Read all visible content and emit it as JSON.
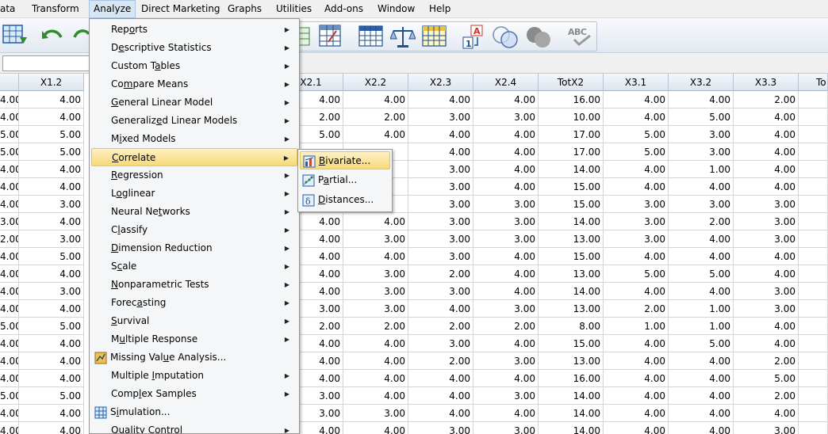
{
  "menubar": {
    "items": [
      "ata",
      "Transform",
      "Analyze",
      "Direct Marketing",
      "Graphs",
      "Utilities",
      "Add-ons",
      "Window",
      "Help"
    ]
  },
  "analyze_menu": {
    "items": [
      {
        "label": "Reports",
        "submenu": true
      },
      {
        "label": "Descriptive Statistics",
        "submenu": true
      },
      {
        "label": "Custom Tables",
        "submenu": true
      },
      {
        "label": "Compare Means",
        "submenu": true
      },
      {
        "label": "General Linear Model",
        "submenu": true
      },
      {
        "label": "Generalized Linear Models",
        "submenu": true
      },
      {
        "label": "Mixed Models",
        "submenu": true
      },
      {
        "label": "Correlate",
        "submenu": true
      },
      {
        "label": "Regression",
        "submenu": true
      },
      {
        "label": "Loglinear",
        "submenu": true
      },
      {
        "label": "Neural Networks",
        "submenu": true
      },
      {
        "label": "Classify",
        "submenu": true
      },
      {
        "label": "Dimension Reduction",
        "submenu": true
      },
      {
        "label": "Scale",
        "submenu": true
      },
      {
        "label": "Nonparametric Tests",
        "submenu": true
      },
      {
        "label": "Forecasting",
        "submenu": true
      },
      {
        "label": "Survival",
        "submenu": true
      },
      {
        "label": "Multiple Response",
        "submenu": true
      },
      {
        "label": "Missing Value Analysis...",
        "submenu": false,
        "icon": "missing-value-icon"
      },
      {
        "label": "Multiple Imputation",
        "submenu": true
      },
      {
        "label": "Complex Samples",
        "submenu": true
      },
      {
        "label": "Simulation...",
        "submenu": false,
        "icon": "simulation-icon"
      },
      {
        "label": "Quality Control",
        "submenu": true
      }
    ],
    "highlighted": "Correlate"
  },
  "correlate_menu": {
    "items": [
      {
        "label": "Bivariate...",
        "icon": "bivariate-icon"
      },
      {
        "label": "Partial...",
        "icon": "partial-icon"
      },
      {
        "label": "Distances...",
        "icon": "distances-icon"
      }
    ],
    "highlighted": "Bivariate..."
  },
  "toolbar": {
    "icons": [
      "dataset-icon",
      "undo-icon",
      "redo-icon",
      "goto-icon",
      "variables-icon",
      "run-descriptives-icon",
      "split-file-icon",
      "weight-cases-icon",
      "select-cases-icon",
      "value-labels-icon",
      "use-sets-icon",
      "show-all-variables-icon",
      "spell-check-icon"
    ],
    "spell_text": "ABC"
  },
  "grid": {
    "left_headers": [
      "",
      "X1.2"
    ],
    "right_headers": [
      "X2.1",
      "X2.2",
      "X2.3",
      "X2.4",
      "TotX2",
      "X3.1",
      "X3.2",
      "X3.3",
      "To"
    ],
    "rows": [
      [
        "4.00",
        "4.00",
        "4.00",
        "4.00",
        "4.00",
        "4.00",
        "16.00",
        "4.00",
        "4.00",
        "2.00"
      ],
      [
        "4.00",
        "4.00",
        "2.00",
        "2.00",
        "3.00",
        "3.00",
        "10.00",
        "4.00",
        "5.00",
        "4.00"
      ],
      [
        "5.00",
        "5.00",
        "5.00",
        "4.00",
        "4.00",
        "4.00",
        "17.00",
        "5.00",
        "3.00",
        "4.00"
      ],
      [
        "5.00",
        "5.00",
        "",
        "",
        "4.00",
        "4.00",
        "17.00",
        "5.00",
        "3.00",
        "4.00"
      ],
      [
        "4.00",
        "4.00",
        "",
        "",
        "3.00",
        "4.00",
        "14.00",
        "4.00",
        "1.00",
        "4.00"
      ],
      [
        "4.00",
        "4.00",
        "",
        "",
        "3.00",
        "4.00",
        "15.00",
        "4.00",
        "4.00",
        "4.00"
      ],
      [
        "4.00",
        "3.00",
        "",
        "",
        "3.00",
        "3.00",
        "15.00",
        "3.00",
        "3.00",
        "3.00"
      ],
      [
        "3.00",
        "4.00",
        "4.00",
        "4.00",
        "3.00",
        "3.00",
        "14.00",
        "3.00",
        "2.00",
        "3.00"
      ],
      [
        "2.00",
        "3.00",
        "4.00",
        "3.00",
        "3.00",
        "3.00",
        "13.00",
        "3.00",
        "4.00",
        "3.00"
      ],
      [
        "4.00",
        "5.00",
        "4.00",
        "4.00",
        "3.00",
        "4.00",
        "15.00",
        "4.00",
        "4.00",
        "4.00"
      ],
      [
        "4.00",
        "4.00",
        "4.00",
        "3.00",
        "2.00",
        "4.00",
        "13.00",
        "5.00",
        "5.00",
        "4.00"
      ],
      [
        "4.00",
        "3.00",
        "4.00",
        "3.00",
        "3.00",
        "4.00",
        "14.00",
        "4.00",
        "4.00",
        "3.00"
      ],
      [
        "4.00",
        "4.00",
        "3.00",
        "3.00",
        "4.00",
        "3.00",
        "13.00",
        "2.00",
        "1.00",
        "3.00"
      ],
      [
        "5.00",
        "5.00",
        "2.00",
        "2.00",
        "2.00",
        "2.00",
        "8.00",
        "1.00",
        "1.00",
        "4.00"
      ],
      [
        "4.00",
        "4.00",
        "4.00",
        "4.00",
        "3.00",
        "4.00",
        "15.00",
        "4.00",
        "5.00",
        "4.00"
      ],
      [
        "4.00",
        "4.00",
        "4.00",
        "4.00",
        "2.00",
        "3.00",
        "13.00",
        "4.00",
        "4.00",
        "2.00"
      ],
      [
        "4.00",
        "4.00",
        "4.00",
        "4.00",
        "4.00",
        "4.00",
        "16.00",
        "4.00",
        "4.00",
        "5.00"
      ],
      [
        "5.00",
        "5.00",
        "3.00",
        "4.00",
        "4.00",
        "3.00",
        "14.00",
        "4.00",
        "4.00",
        "2.00"
      ],
      [
        "4.00",
        "4.00",
        "3.00",
        "3.00",
        "4.00",
        "4.00",
        "14.00",
        "4.00",
        "4.00",
        "4.00"
      ],
      [
        "4.00",
        "4.00",
        "4.00",
        "4.00",
        "3.00",
        "3.00",
        "14.00",
        "4.00",
        "4.00",
        "3.00"
      ]
    ]
  }
}
